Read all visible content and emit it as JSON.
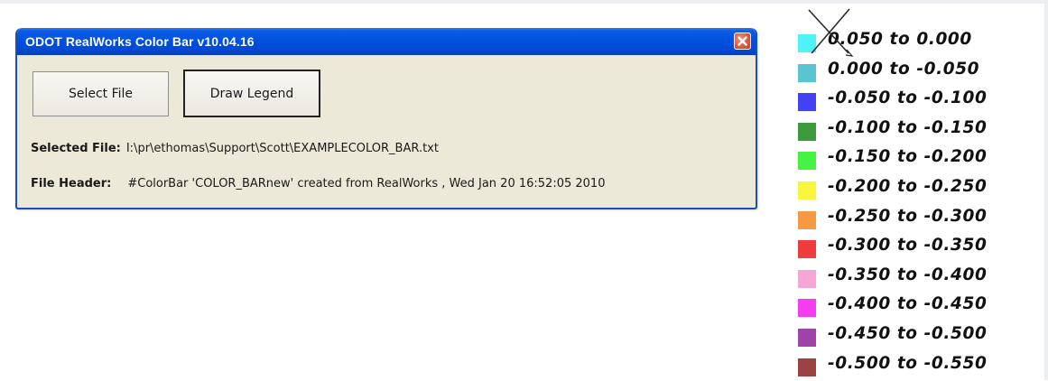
{
  "window": {
    "title": "ODOT RealWorks Color Bar v10.04.16",
    "close_icon": "close-icon"
  },
  "buttons": {
    "select_file": "Select File",
    "draw_legend": "Draw Legend"
  },
  "info": {
    "selected_file_label": "Selected File:",
    "selected_file_value": "I:\\pr\\ethomas\\Support\\Scott\\EXAMPLECOLOR_BAR.txt",
    "file_header_label": "File Header:",
    "file_header_value": "#ColorBar 'COLOR_BARnew' created from RealWorks , Wed Jan 20 16:52:05 2010"
  },
  "legend": {
    "items": [
      {
        "label": "0.050 to 0.000",
        "color": "#4ff3f7"
      },
      {
        "label": "0.000 to -0.050",
        "color": "#59c5d0"
      },
      {
        "label": "-0.050 to -0.100",
        "color": "#4242f2"
      },
      {
        "label": "-0.100 to -0.150",
        "color": "#3c9a3c"
      },
      {
        "label": "-0.150 to -0.200",
        "color": "#43f243"
      },
      {
        "label": "-0.200 to -0.250",
        "color": "#f7f53c"
      },
      {
        "label": "-0.250 to -0.300",
        "color": "#f59a43"
      },
      {
        "label": "-0.300 to -0.350",
        "color": "#ee3c3c"
      },
      {
        "label": "-0.350 to -0.400",
        "color": "#f5a6d6"
      },
      {
        "label": "-0.400 to -0.450",
        "color": "#f53cf0"
      },
      {
        "label": "-0.450 to -0.500",
        "color": "#a043a6"
      },
      {
        "label": "-0.500 to -0.550",
        "color": "#9c4242"
      }
    ]
  },
  "cursor": {
    "icon": "x-cursor-icon"
  }
}
